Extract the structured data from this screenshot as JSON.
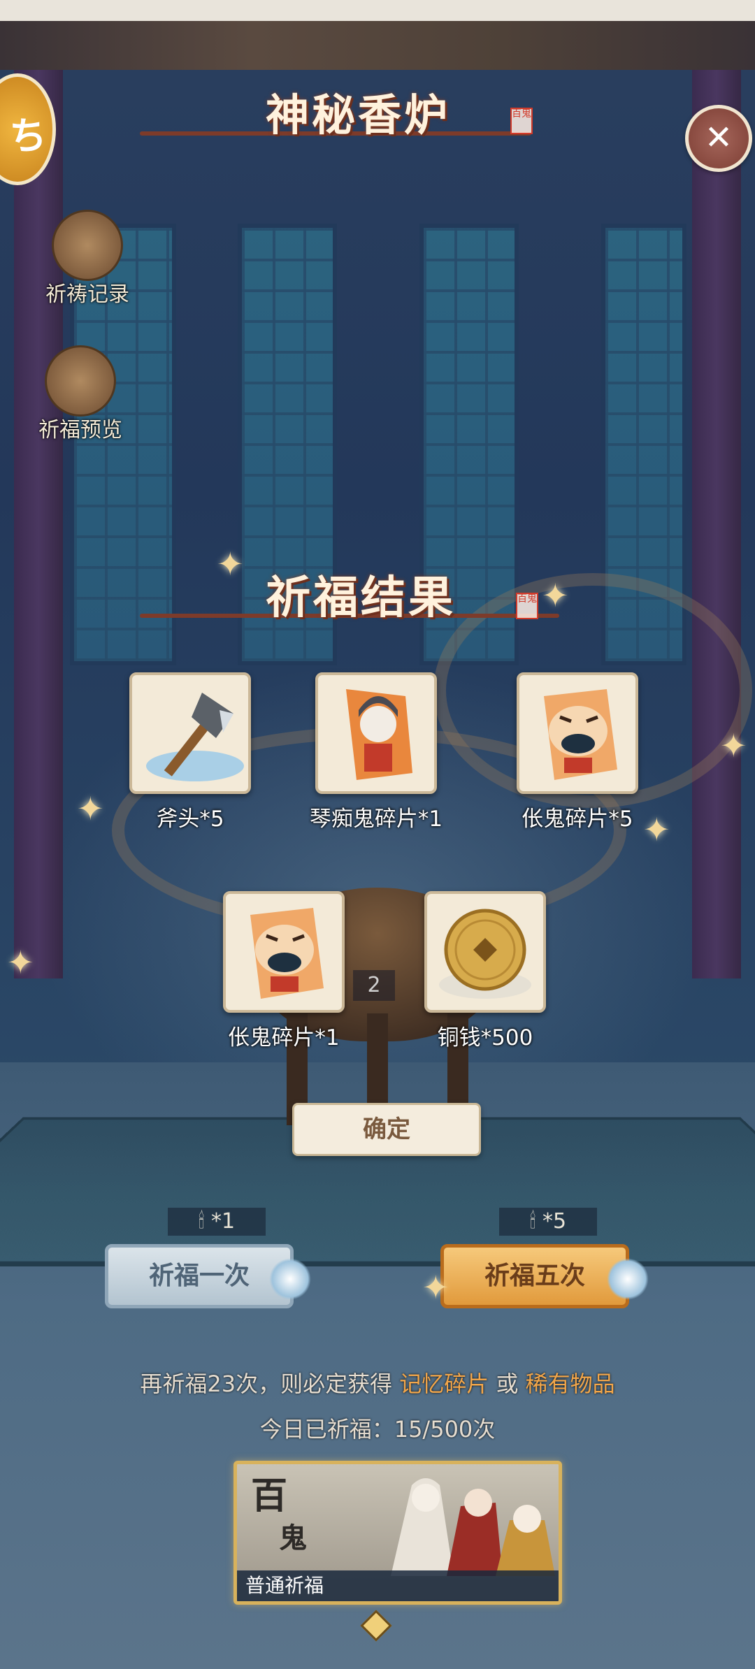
{
  "header": {
    "title": "神秘香炉",
    "seal": "百鬼"
  },
  "corner_badge": {
    "glyph": "ち",
    "icon": "app-badge-icon"
  },
  "close": {
    "glyph": "✕",
    "icon": "close-icon"
  },
  "side": {
    "records_label": "祈祷记录",
    "records_icon": "scroll-icon",
    "preview_label": "祈福预览",
    "preview_icon": "incense-sticks-icon"
  },
  "result": {
    "title": "祈福结果",
    "seal": "百鬼",
    "items": [
      {
        "name": "斧头*5",
        "icon": "axe-icon"
      },
      {
        "name": "琴痴鬼碎片*1",
        "icon": "qin-ghost-shard-icon"
      },
      {
        "name": "伥鬼碎片*5",
        "icon": "tiger-ghost-shard-icon"
      },
      {
        "name": "伥鬼碎片*1",
        "icon": "tiger-ghost-shard-icon"
      },
      {
        "name": "铜钱*500",
        "icon": "copper-coin-icon"
      }
    ],
    "badge_number": "2",
    "confirm_label": "确定"
  },
  "pray": {
    "one_cost": "*1",
    "one_label": "祈福一次",
    "five_cost": "*5",
    "five_label": "祈福五次"
  },
  "hint": {
    "prefix": "再祈福23次，则必定获得",
    "item1": "记忆碎片",
    "or": "或",
    "item2": "稀有物品"
  },
  "count_text": "今日已祈福：15/500次",
  "pool": {
    "big": "百",
    "big2": "鬼",
    "label": "普通祈福"
  },
  "colors": {
    "accent": "#f2a64a",
    "title_text": "#fff2dd",
    "card_bg": "#f3ead8"
  }
}
